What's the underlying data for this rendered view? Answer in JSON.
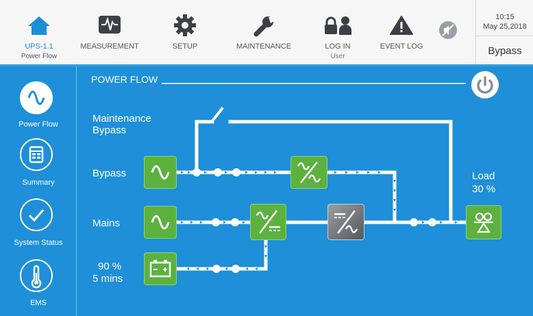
{
  "header": {
    "nav": [
      {
        "label": "UPS-1.1",
        "sub": "Power Flow",
        "icon": "home-icon"
      },
      {
        "label": "MEASUREMENT",
        "icon": "waveform-icon"
      },
      {
        "label": "SETUP",
        "icon": "gear-icon"
      },
      {
        "label": "MAINTENANCE",
        "icon": "wrench-icon"
      },
      {
        "label": "LOG IN",
        "sub": "User",
        "icon": "login-icon"
      },
      {
        "label": "EVENT LOG",
        "icon": "warning-icon"
      }
    ],
    "mute_icon": "mute-icon",
    "time": "10:15",
    "date": "May 25,2018",
    "mode": "Bypass"
  },
  "sidebar": {
    "items": [
      {
        "label": "Power Flow",
        "icon": "sine-wave-icon",
        "active": true
      },
      {
        "label": "Summary",
        "icon": "summary-icon",
        "active": false
      },
      {
        "label": "System Status",
        "icon": "checkmark-icon",
        "active": false
      },
      {
        "label": "EMS",
        "icon": "thermometer-icon",
        "active": false
      }
    ]
  },
  "main": {
    "title": "POWER FLOW",
    "power_button_icon": "power-icon",
    "labels": {
      "maintenance_bypass_1": "Maintenance",
      "maintenance_bypass_2": "Bypass",
      "bypass": "Bypass",
      "mains": "Mains",
      "battery_level": "90 %",
      "battery_time": "5 mins",
      "load": "Load",
      "load_percent": "30 %"
    }
  },
  "colors": {
    "background_blue": "#1e8fd8",
    "module_green": "#5cb13f",
    "inverter_gray": "#6f7378",
    "accent_blue": "#1a8fd6"
  }
}
